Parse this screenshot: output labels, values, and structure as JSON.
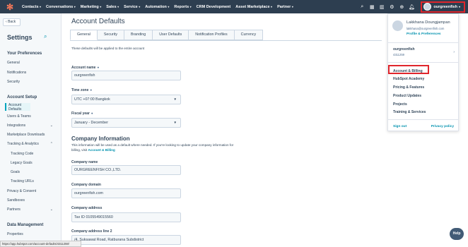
{
  "topnav": {
    "items": [
      "Contacts",
      "Conversations",
      "Marketing",
      "Sales",
      "Service",
      "Automation",
      "Reports",
      "CRM Development",
      "Asset Marketplace",
      "Partner"
    ],
    "has_chevron": [
      true,
      true,
      true,
      true,
      true,
      true,
      true,
      false,
      true,
      true
    ],
    "account_name": "ourgreenfish"
  },
  "sidebar": {
    "back": "Back",
    "title": "Settings",
    "sections": {
      "preferences": "Your Preferences",
      "setup": "Account Setup",
      "data": "Data Management"
    },
    "preferences_items": [
      "General",
      "Notifications",
      "Security"
    ],
    "setup_items": [
      "Account Defaults",
      "Users & Teams",
      "Integrations",
      "Marketplace Downloads",
      "Tracking & Analytics"
    ],
    "tracking_items": [
      "Tracking Code",
      "Legacy Goals",
      "Goals",
      "Tracking URLs"
    ],
    "more_items": [
      "Privacy & Consent",
      "Sandboxes",
      "Partners"
    ],
    "data_items": [
      "Properties"
    ]
  },
  "main": {
    "title": "Account Defaults",
    "tabs": [
      "General",
      "Security",
      "Branding",
      "User Defaults",
      "Notification Profiles",
      "Currency"
    ],
    "note": "These defaults will be applied to the entire account",
    "account_name_label": "Account name",
    "account_name_value": "ourgreenfish",
    "timezone_label": "Time zone",
    "timezone_value": "UTC +07:00 Bangkok",
    "fiscal_label": "Fiscal year",
    "fiscal_value": "January - December",
    "company_heading": "Company Information",
    "company_desc": "This information will be used as a default where needed. If you're looking to update your company information for billing, visit",
    "company_desc_link": "Account & Billing",
    "company_name_label": "Company name",
    "company_name_value": "OURGREENFISH CO.,LTD.",
    "company_domain_label": "Company domain",
    "company_domain_value": "ourgreenfish.com",
    "company_address_label": "Company address",
    "company_address_value": "Tax ID 0105549015560",
    "company_address2_label": "Company address line 2",
    "company_address2_value": "/4, Suksawat Road, Ratburana Subdistrict"
  },
  "dropdown": {
    "user_name": "Lakkhana Doungjampan",
    "email": "lakkhana@ourgreenfish.com",
    "profile_link": "Profile & Preferences",
    "account": "ourgreenfish",
    "account_id": "4311259",
    "items": [
      "Account & Billing",
      "HubSpot Academy",
      "Pricing & Features",
      "Product Updates",
      "Projects",
      "Training & Services"
    ],
    "sign_out": "Sign out",
    "privacy": "Privacy policy"
  },
  "status_url": "https://app.hubspot.com/account-defaults/4311259/",
  "help": "Help"
}
